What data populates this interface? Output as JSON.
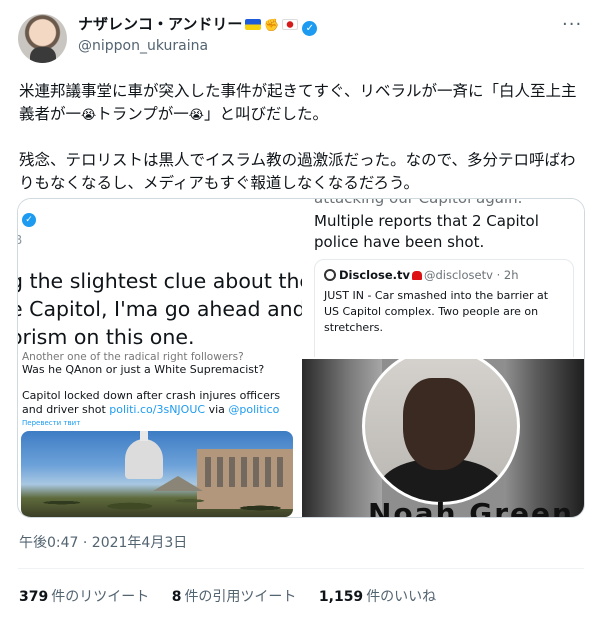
{
  "author": {
    "name": "ナザレンコ・アンドリー",
    "handle": "@nippon_ukuraina"
  },
  "more_label": "···",
  "tweet": {
    "p1_a": "米連邦議事堂に車が突入した事件が起きてすぐ、リベラルが一斉に「白人至上主義者が一",
    "emoji": "😭",
    "p1_b": "トランプが一",
    "p1_c": "」と叫びだした。",
    "p2": "残念、テロリストは黒人でイスラム教の過激派だった。なので、多分テロ呼ばわりもなくなるし、メディアもすぐ報道しなくなるだろう。"
  },
  "media": {
    "q1": {
      "b": "B",
      "lines": [
        "g the slightest clue about the",
        "e Capitol, I'ma go ahead and",
        "orism on this one."
      ]
    },
    "q2": {
      "cut": "attacking our Capitol again.",
      "text": "Multiple reports that 2 Capitol police have been shot.",
      "card": {
        "name": "Disclose.tv",
        "handle": "@disclosetv · 2h",
        "body": "JUST IN - Car smashed into the barrier at US Capitol complex. Two people are on stretchers."
      }
    },
    "q3": {
      "top": "Another one of the radical right followers?",
      "l1": "Was he QAnon or just a White Supremacist?",
      "l2a": "Capitol locked down after crash injures officers and driver shot ",
      "link": "politi.co/3sNJOUC",
      "via": " via ",
      "politico": "@politico",
      "translate": "Перевести твит"
    },
    "q4": {
      "partial_name": "Noah Green"
    }
  },
  "timestamp": "午後0:47 · 2021年4月3日",
  "stats": {
    "retweets_count": "379",
    "retweets_label": "件のリツイート",
    "quotes_count": "8",
    "quotes_label": "件の引用ツイート",
    "likes_count": "1,159",
    "likes_label": "件のいいね"
  }
}
